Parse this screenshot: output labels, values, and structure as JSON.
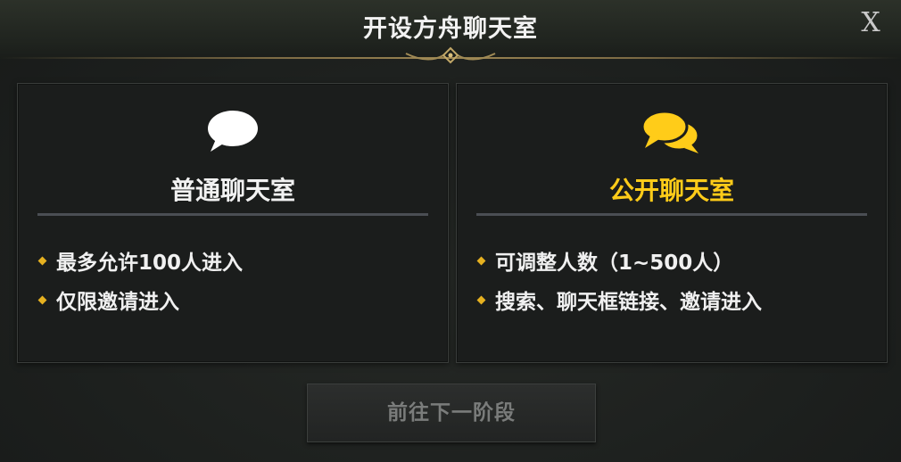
{
  "dialog": {
    "title": "开设方舟聊天室",
    "close_label": "X"
  },
  "cards": {
    "normal": {
      "title": "普通聊天室",
      "icon": "speech-bubble-icon",
      "features": [
        "最多允许100人进入",
        "仅限邀请进入"
      ]
    },
    "public": {
      "title": "公开聊天室",
      "icon": "double-speech-bubble-icon",
      "features": [
        "可调整人数（1~500人）",
        "搜索、聊天框链接、邀请进入"
      ]
    }
  },
  "footer": {
    "next_label": "前往下一阶段",
    "next_enabled": false
  },
  "colors": {
    "accent_gold": "#ffcc19",
    "bullet_gold": "#e6b120",
    "text_primary": "#f2f2f2",
    "disabled_text": "#7a7c7b"
  }
}
